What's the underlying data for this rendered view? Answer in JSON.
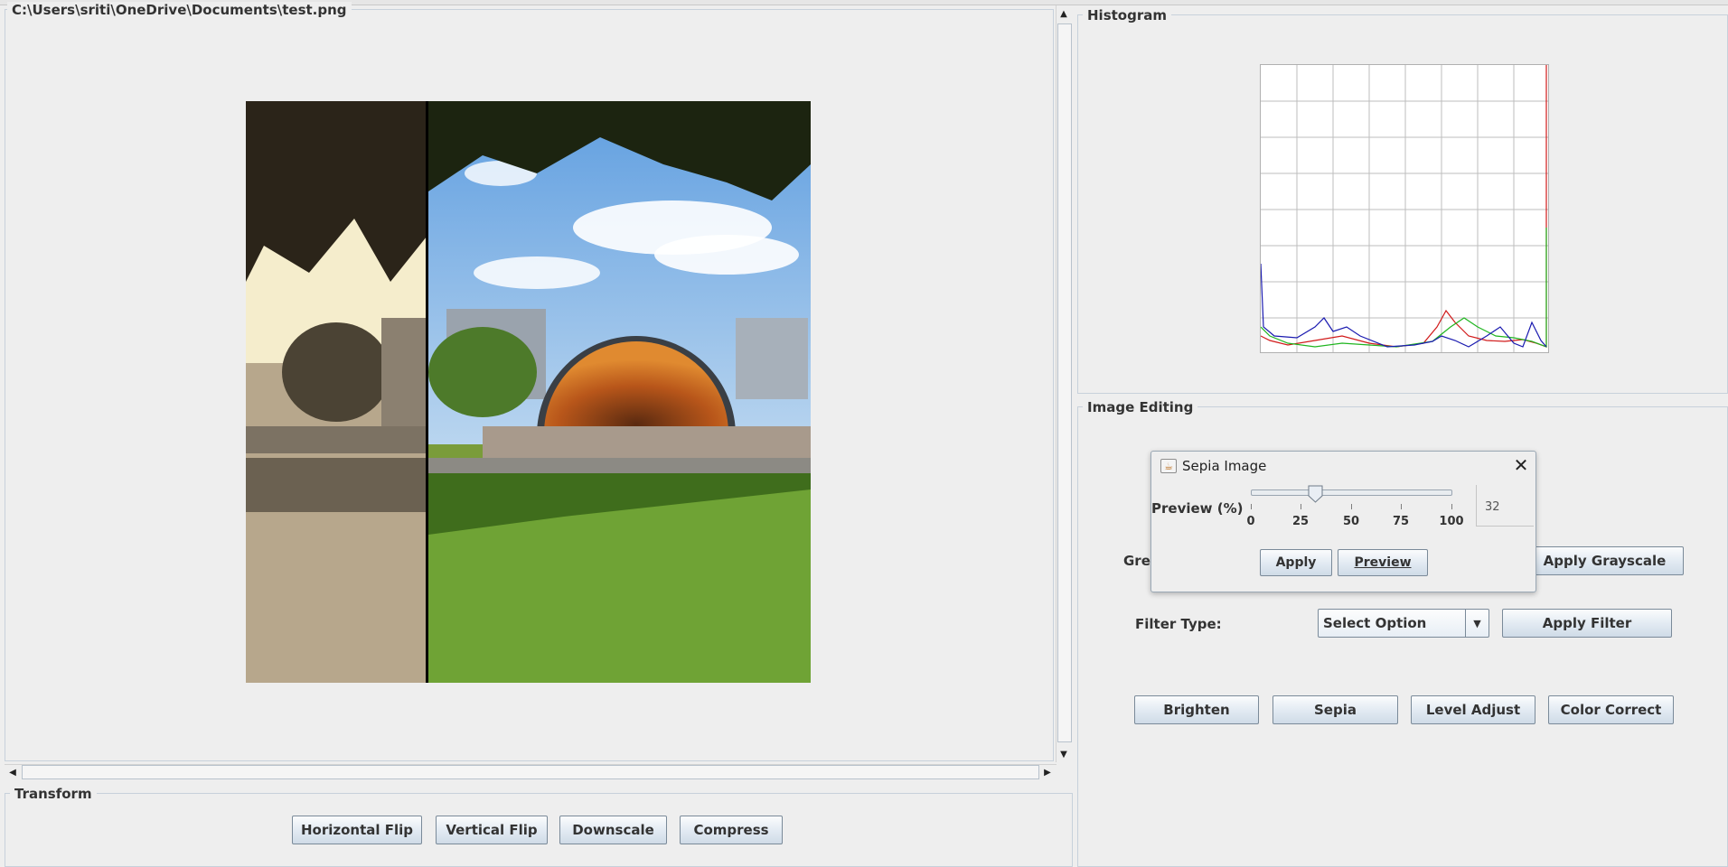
{
  "viewer": {
    "file_path": "C:\\Users\\sriti\\OneDrive\\Documents\\test.png"
  },
  "transform": {
    "title": "Transform",
    "buttons": [
      "Horizontal Flip",
      "Vertical Flip",
      "Downscale",
      "Compress"
    ]
  },
  "histogram": {
    "title": "Histogram"
  },
  "editing": {
    "title": "Image Editing",
    "grayscale_label_partial": "Grey",
    "apply_grayscale": "Apply Grayscale",
    "filter_type_label": "Filter Type:",
    "filter_select_value": "Select Option",
    "apply_filter": "Apply Filter",
    "buttons": [
      "Brighten",
      "Sepia",
      "Level Adjust",
      "Color Correct"
    ]
  },
  "dialog": {
    "title": "Sepia Image",
    "preview_label": "Preview (%)",
    "slider_value": 32,
    "slider_ticks": [
      "0",
      "25",
      "50",
      "75",
      "100"
    ],
    "value_display": "32",
    "apply": "Apply",
    "preview": "Preview"
  },
  "colors": {
    "panel_bg": "#eeeeee",
    "histogram_red": "#d11a1a",
    "histogram_green": "#1fb51f",
    "histogram_blue": "#1a1ab0"
  }
}
